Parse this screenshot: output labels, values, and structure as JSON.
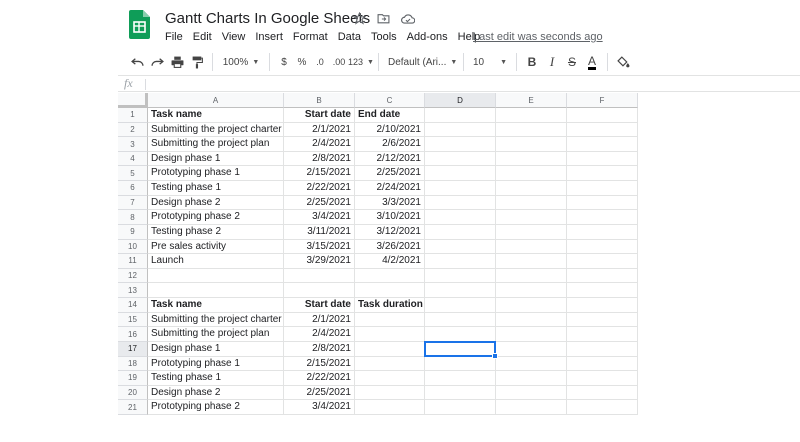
{
  "header": {
    "title": "Gantt Charts In Google Sheets",
    "icons": [
      "star-icon",
      "move-to-folder-icon",
      "cloud-status-icon"
    ],
    "menus": [
      "File",
      "Edit",
      "View",
      "Insert",
      "Format",
      "Data",
      "Tools",
      "Add-ons",
      "Help"
    ],
    "last_edit": "Last edit was seconds ago"
  },
  "toolbar": {
    "zoom": "100%",
    "currency": "$",
    "percent": "%",
    "decrease_decimals": ".0",
    "increase_decimals": ".00",
    "more_formats": "123",
    "font": "Default (Ari...",
    "font_size": "10",
    "bold": "B",
    "italic": "I",
    "strikethrough": "S",
    "text_color": "A"
  },
  "formula_bar": {
    "fx": "fx",
    "value": ""
  },
  "grid": {
    "columns": [
      "A",
      "B",
      "C",
      "D",
      "E",
      "F"
    ],
    "selected_column": "D",
    "selected_row": "17",
    "rows": [
      {
        "n": "1",
        "a": "Task name",
        "b": "Start date",
        "c": "End date",
        "bold": true
      },
      {
        "n": "2",
        "a": "Submitting the project charter",
        "b": "2/1/2021",
        "c": "2/10/2021"
      },
      {
        "n": "3",
        "a": "Submitting the project plan",
        "b": "2/4/2021",
        "c": "2/6/2021"
      },
      {
        "n": "4",
        "a": "Design phase 1",
        "b": "2/8/2021",
        "c": "2/12/2021"
      },
      {
        "n": "5",
        "a": "Prototyping phase 1",
        "b": "2/15/2021",
        "c": "2/25/2021"
      },
      {
        "n": "6",
        "a": "Testing phase 1",
        "b": "2/22/2021",
        "c": "2/24/2021"
      },
      {
        "n": "7",
        "a": "Design phase 2",
        "b": "2/25/2021",
        "c": "3/3/2021"
      },
      {
        "n": "8",
        "a": "Prototyping phase 2",
        "b": "3/4/2021",
        "c": "3/10/2021"
      },
      {
        "n": "9",
        "a": "Testing phase 2",
        "b": "3/11/2021",
        "c": "3/12/2021"
      },
      {
        "n": "10",
        "a": "Pre sales activity",
        "b": "3/15/2021",
        "c": "3/26/2021"
      },
      {
        "n": "11",
        "a": "Launch",
        "b": "3/29/2021",
        "c": "4/2/2021"
      },
      {
        "n": "12",
        "a": "",
        "b": "",
        "c": ""
      },
      {
        "n": "13",
        "a": "",
        "b": "",
        "c": ""
      },
      {
        "n": "14",
        "a": "Task name",
        "b": "Start date",
        "c": "Task duration",
        "bold": true
      },
      {
        "n": "15",
        "a": "Submitting the project charter",
        "b": "2/1/2021",
        "c": ""
      },
      {
        "n": "16",
        "a": "Submitting the project plan",
        "b": "2/4/2021",
        "c": ""
      },
      {
        "n": "17",
        "a": "Design phase 1",
        "b": "2/8/2021",
        "c": ""
      },
      {
        "n": "18",
        "a": "Prototyping phase 1",
        "b": "2/15/2021",
        "c": ""
      },
      {
        "n": "19",
        "a": "Testing phase 1",
        "b": "2/22/2021",
        "c": ""
      },
      {
        "n": "20",
        "a": "Design phase 2",
        "b": "2/25/2021",
        "c": ""
      },
      {
        "n": "21",
        "a": "Prototyping phase 2",
        "b": "3/4/2021",
        "c": ""
      }
    ]
  },
  "colors": {
    "selection": "#1a73e8",
    "logo": "#0f9d58",
    "header_bg": "#f8f9fa",
    "gridline": "#e2e3e3"
  }
}
